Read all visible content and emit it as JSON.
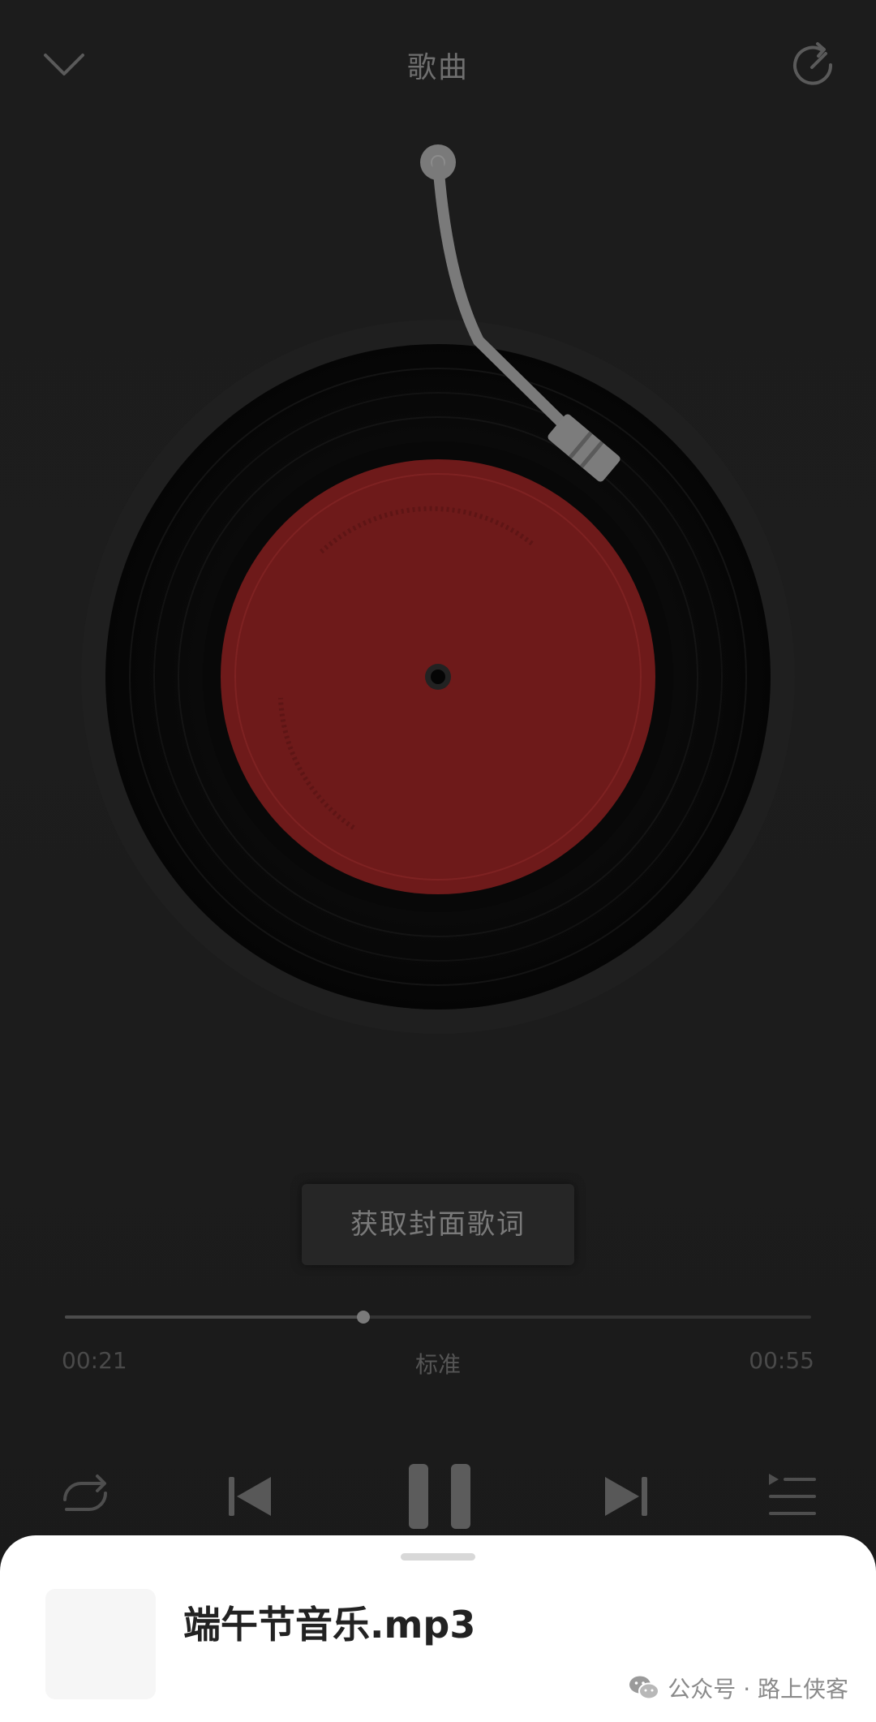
{
  "header": {
    "title": "歌曲",
    "back_icon": "chevron-down-icon",
    "share_icon": "share-icon"
  },
  "colors": {
    "background": "#1c1c1c",
    "record_label": "#6e1a1a",
    "vinyl": "#0a0a0a"
  },
  "turntable": {
    "record_icon": "vinyl-record-icon",
    "tonearm_icon": "tonearm-icon"
  },
  "fetch_button": {
    "label": "获取封面歌词"
  },
  "playback": {
    "current_time": "00:21",
    "duration": "00:55",
    "progress": 0.4,
    "speed_label": "标准"
  },
  "controls": {
    "repeat_icon": "repeat-icon",
    "previous_icon": "skip-previous-icon",
    "pause_icon": "pause-icon",
    "next_icon": "skip-next-icon",
    "playlist_icon": "playlist-icon"
  },
  "now_playing": {
    "filename": "端午节音乐.mp3"
  },
  "watermark": {
    "text": "公众号 · 路上侠客",
    "icon": "wechat-icon"
  }
}
